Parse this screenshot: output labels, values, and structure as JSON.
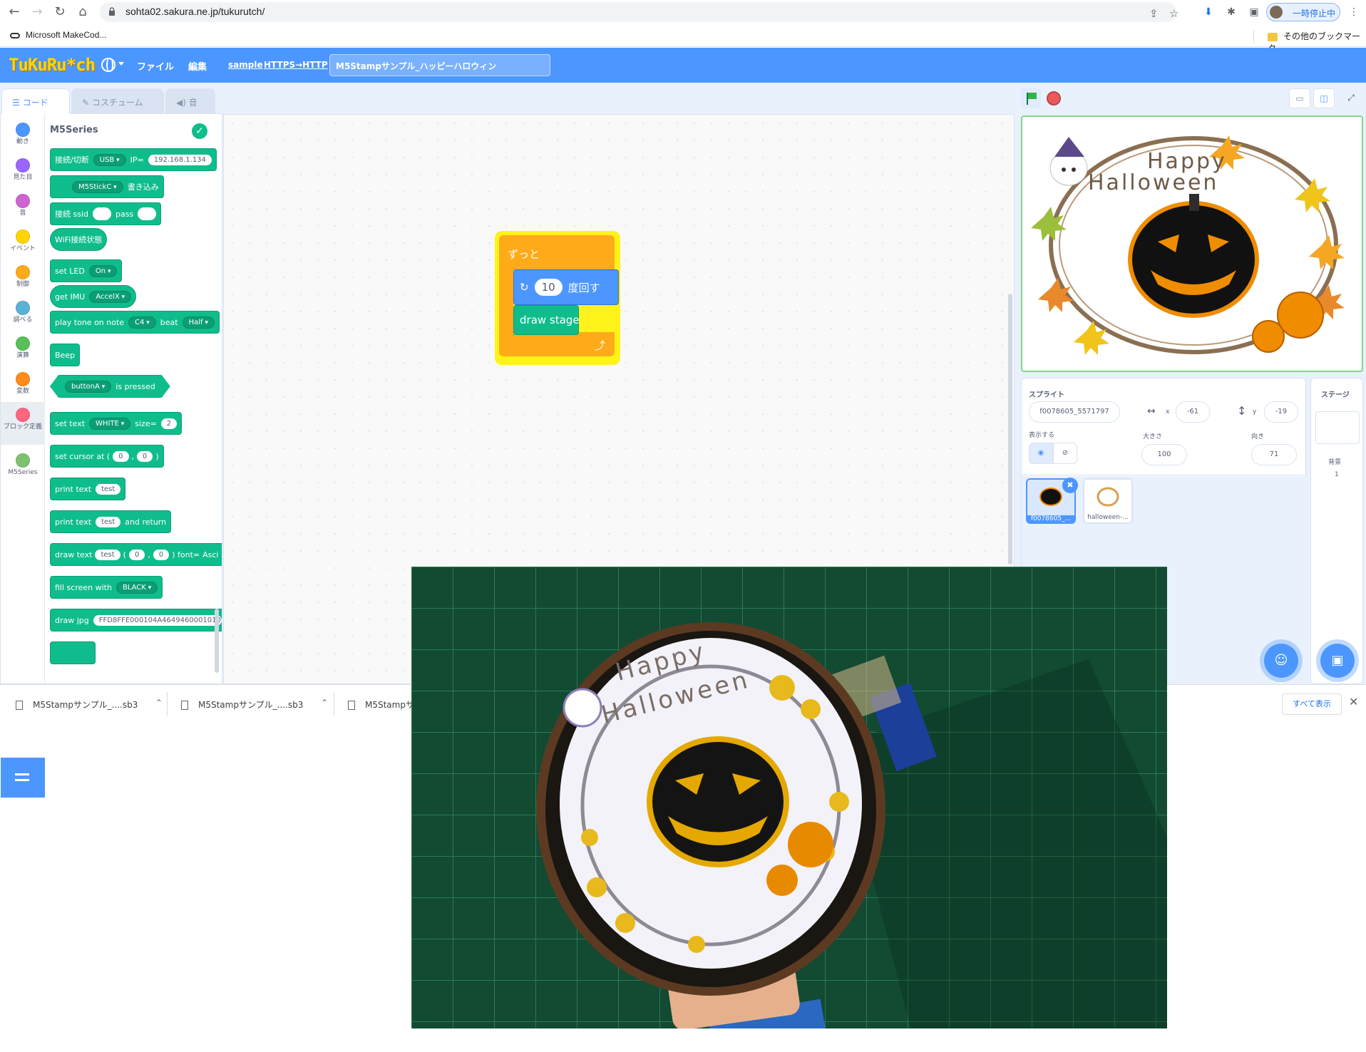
{
  "browser": {
    "url": "sohta02.sakura.ne.jp/tukurutch/",
    "bookmark_left": "Microsoft MakeCod...",
    "bookmark_right": "その他のブックマーク",
    "profile_status": "一時停止中"
  },
  "menubar": {
    "logo": "TuKuRu*ch",
    "file": "ファイル",
    "edit": "編集",
    "link_sample": "sample",
    "link_https": "HTTPS→HTTP",
    "project_title": "M5Stampサンプル_ハッピーハロウィン"
  },
  "tabs": {
    "code": "コード",
    "costume": "コスチューム",
    "sound": "音"
  },
  "categories": [
    {
      "label": "動き",
      "color": "#4c97ff"
    },
    {
      "label": "見た目",
      "color": "#9966ff"
    },
    {
      "label": "音",
      "color": "#cf63cf"
    },
    {
      "label": "イベント",
      "color": "#ffd500"
    },
    {
      "label": "制御",
      "color": "#ffab19"
    },
    {
      "label": "調べる",
      "color": "#5cb1d6"
    },
    {
      "label": "演算",
      "color": "#59c059"
    },
    {
      "label": "変数",
      "color": "#ff8c1a"
    },
    {
      "label": "ブロック定義",
      "color": "#ff6680"
    },
    {
      "label": "M5Series",
      "color": "#7ec26f"
    }
  ],
  "palette": {
    "title": "M5Series",
    "blocks": {
      "connect_label": "接続/切断",
      "connect_mode": "USB",
      "ip_label": "IP=",
      "ip_value": "192.168.1.134",
      "device": "M5StickC",
      "write": "書き込み",
      "wifi_label": "接続 ssid",
      "pass_label": "pass",
      "wifi_status": "WiFi接続状態",
      "led_label": "set LED",
      "led_value": "On",
      "imu_label": "get IMU",
      "imu_value": "AccelX",
      "tone_label": "play tone on note",
      "tone_note": "C4",
      "beat_label": "beat",
      "beat_value": "Half",
      "beep": "Beep",
      "button": "buttonA",
      "is_pressed": "is pressed",
      "settext_label": "set text",
      "settext_color": "WHITE",
      "size_label": "size=",
      "size_value": "2",
      "cursor_label": "set cursor at (",
      "cursor_x": "0",
      "cursor_comma": ",",
      "cursor_y": "0",
      "cursor_close": ")",
      "print_label": "print text",
      "print_value": "test",
      "print2_label": "print text",
      "print2_value": "test",
      "print2_suffix": "and return",
      "draw_label": "draw text",
      "draw_value": "test",
      "draw_paren": "(",
      "draw_x": "0",
      "draw_comma": ",",
      "draw_y": "0",
      "draw_font": ") font=",
      "draw_font_value": "Asci",
      "fill_label": "fill screen with",
      "fill_value": "BLACK",
      "jpg_label": "draw jpg",
      "jpg_value": "FFD8FFE000104A46494600010101"
    }
  },
  "script": {
    "forever": "ずっと",
    "repeat_count": "10",
    "repeat_label": "度回す",
    "draw_stage": "draw stage"
  },
  "stage_image": {
    "line1": "Happy",
    "line2": "Halloween"
  },
  "sprite_info": {
    "heading": "スプライト",
    "name": "f0078605_5571797",
    "x_label": "x",
    "x_value": "-61",
    "y_label": "y",
    "y_value": "-19",
    "show_label": "表示する",
    "size_label": "大きさ",
    "size_value": "100",
    "direction_label": "向き",
    "direction_value": "71"
  },
  "sprites": [
    {
      "name": "f0078605_..."
    },
    {
      "name": "halloween-..."
    }
  ],
  "stage_pane": {
    "heading": "ステージ",
    "backdrop_label": "背景",
    "backdrop_count": "1"
  },
  "downloads": {
    "item1": "M5Stampサンプル_....sb3",
    "item2": "M5Stampサンプル_....sb3",
    "item3": "M5Stampサ",
    "show_all": "すべて表示"
  },
  "colors": {
    "accent": "#4c97ff",
    "extension_block": "#0fbd8c",
    "control_block": "#ffab19"
  }
}
